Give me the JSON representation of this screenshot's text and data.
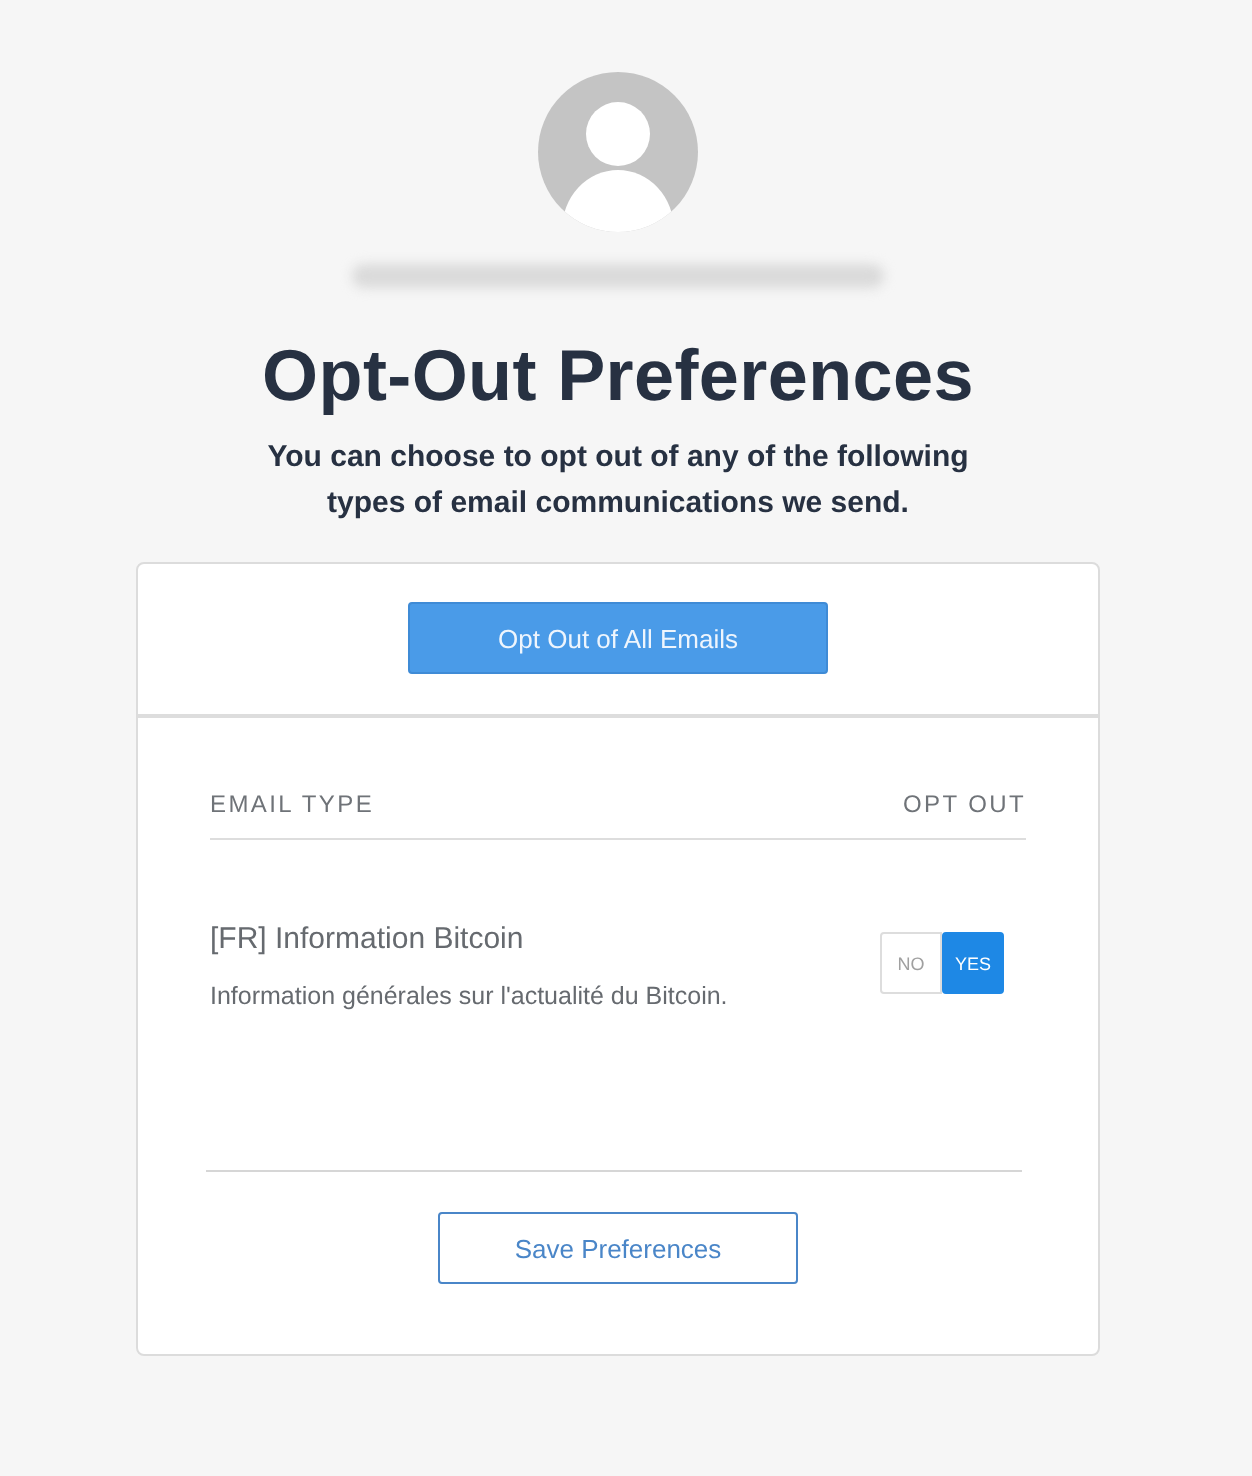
{
  "title": "Opt-Out Preferences",
  "subtitle": "You can choose to opt out of any of the following types of email communications we send.",
  "opt_out_all_button": "Opt Out of All Emails",
  "table": {
    "columns": [
      "EMAIL TYPE",
      "OPT OUT"
    ],
    "rows": [
      {
        "name": "[FR] Information Bitcoin",
        "description": "Information générales sur l'actualité du Bitcoin.",
        "options": [
          {
            "label": "NO",
            "selected": false
          },
          {
            "label": "YES",
            "selected": true
          }
        ]
      }
    ]
  },
  "save_button": "Save Preferences"
}
